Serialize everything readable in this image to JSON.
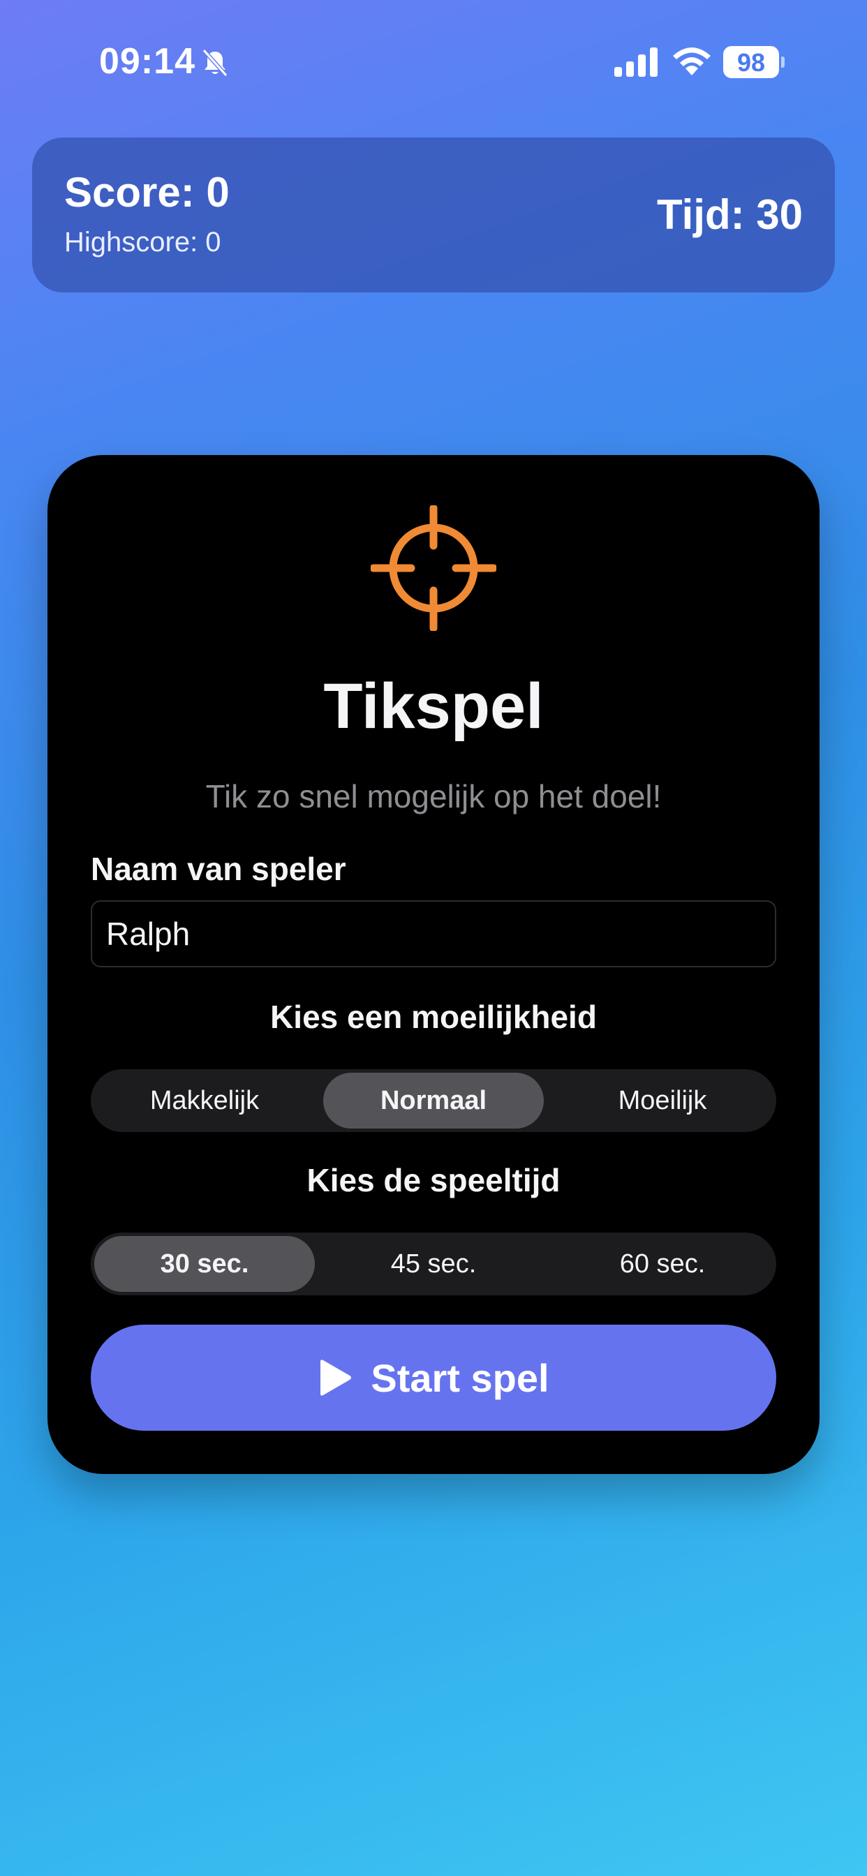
{
  "status_bar": {
    "time": "09:14",
    "battery": "98",
    "icons": [
      "bell-slash-icon",
      "cellular-signal-icon",
      "wifi-icon",
      "battery-icon"
    ]
  },
  "header": {
    "score_label": "Score: 0",
    "highscore_label": "Highscore: 0",
    "time_label": "Tijd: 30"
  },
  "game": {
    "icon": "crosshair-target-icon",
    "title": "Tikspel",
    "subtitle": "Tik zo snel mogelijk op het doel!",
    "name_label": "Naam van speler",
    "name_value": "Ralph",
    "difficulty_label": "Kies een moeilijkheid",
    "difficulty_options": [
      "Makkelijk",
      "Normaal",
      "Moeilijk"
    ],
    "difficulty_selected": "Normaal",
    "time_label": "Kies de speeltijd",
    "time_options": [
      "30 sec.",
      "45 sec.",
      "60 sec."
    ],
    "time_selected": "30 sec.",
    "start_label": "Start spel"
  },
  "colors": {
    "accent_orange": "#f08a34",
    "button_purple": "#6673ef",
    "card_background": "#000000",
    "segment_selected": "#545458"
  }
}
